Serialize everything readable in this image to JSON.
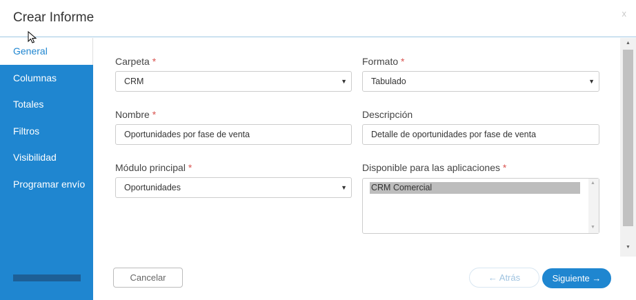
{
  "header": {
    "title": "Crear Informe",
    "close_label": "x"
  },
  "sidebar": {
    "items": [
      {
        "label": "General"
      },
      {
        "label": "Columnas"
      },
      {
        "label": "Totales"
      },
      {
        "label": "Filtros"
      },
      {
        "label": "Visibilidad"
      },
      {
        "label": "Programar envío"
      }
    ]
  },
  "form": {
    "carpeta": {
      "label": "Carpeta",
      "required_mark": "*",
      "value": "CRM"
    },
    "formato": {
      "label": "Formato",
      "required_mark": "*",
      "value": "Tabulado"
    },
    "nombre": {
      "label": "Nombre",
      "required_mark": "*",
      "value": "Oportunidades por fase de venta"
    },
    "descripcion": {
      "label": "Descripción",
      "value": "Detalle de oportunidades por fase de venta"
    },
    "modulo": {
      "label": "Módulo principal",
      "required_mark": "*",
      "value": "Oportunidades"
    },
    "aplicaciones": {
      "label": "Disponible para las aplicaciones",
      "required_mark": "*",
      "options": [
        "CRM Comercial"
      ]
    }
  },
  "footer": {
    "cancel_label": "Cancelar",
    "back_label": "← Atrás",
    "next_label": "Siguiente →"
  },
  "colors": {
    "accent": "#1f86d0",
    "required": "#d9534f",
    "sidebar_bar": "#1d5f96"
  },
  "icons": {
    "select_arrow": "caret-down-icon",
    "cursor": "mouse-pointer-icon"
  }
}
